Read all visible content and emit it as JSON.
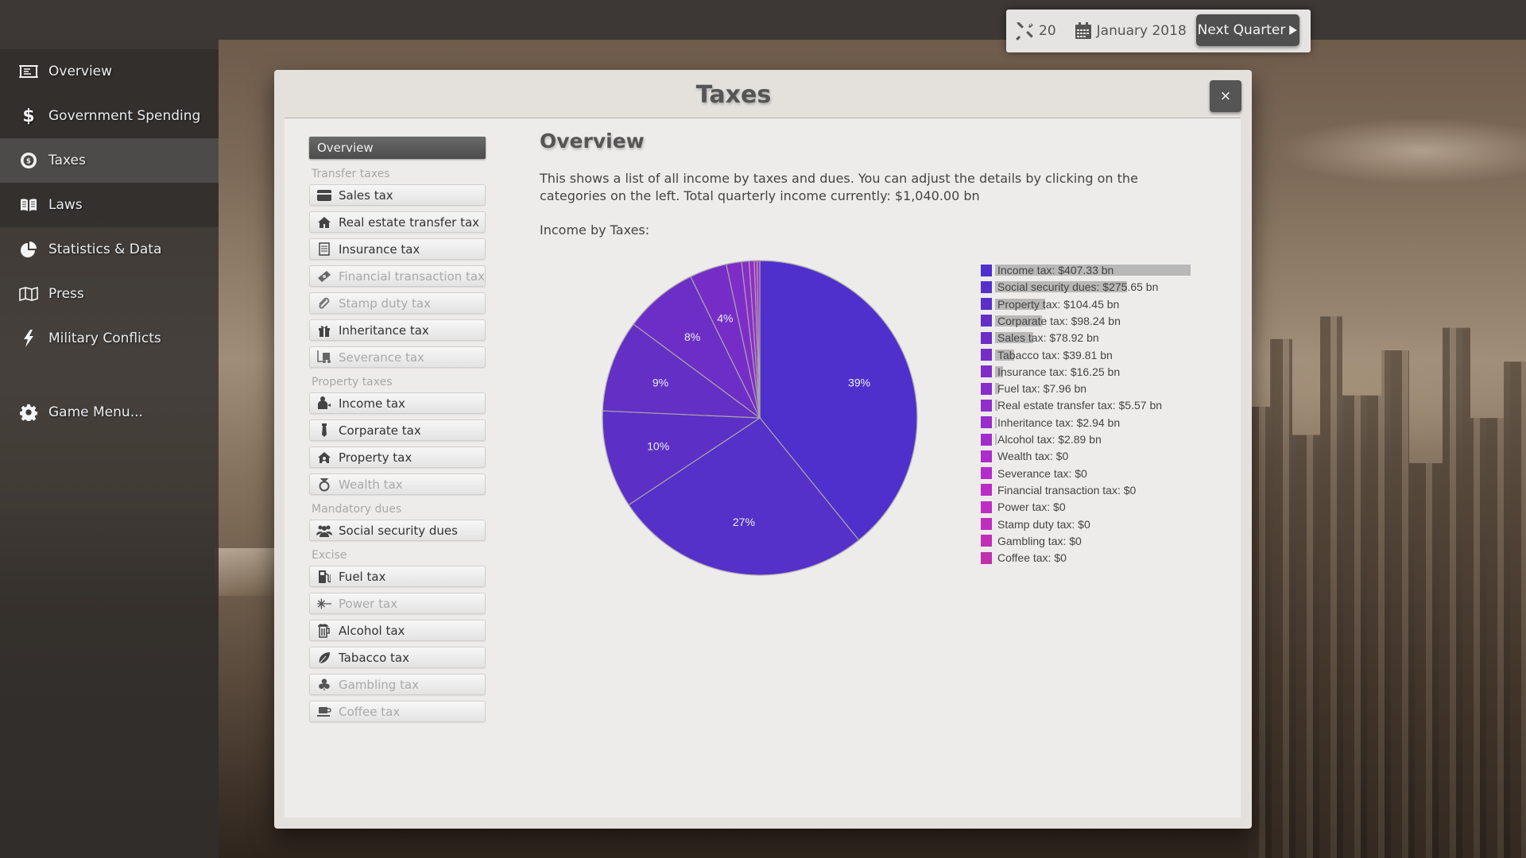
{
  "topbar": {
    "tools_count": "20",
    "tools_icon": "tools-icon",
    "date": "January 2018",
    "calendar_icon": "calendar-icon",
    "next_quarter_label": "Next Quarter",
    "next_quarter_icon": "play-icon"
  },
  "sidebar": {
    "items": [
      {
        "label": "Overview",
        "icon": "newspaper-icon",
        "active": false
      },
      {
        "label": "Government Spending",
        "icon": "dollar-icon",
        "active": false
      },
      {
        "label": "Taxes",
        "icon": "coin-icon",
        "active": true
      },
      {
        "label": "Laws",
        "icon": "book-icon",
        "active": false
      },
      {
        "label": "Statistics & Data",
        "icon": "pie-chart-icon",
        "active": false
      },
      {
        "label": "Press",
        "icon": "map-icon",
        "active": false
      },
      {
        "label": "Military Conflicts",
        "icon": "lightning-icon",
        "active": false
      },
      {
        "label": "Game Menu...",
        "icon": "gear-icon",
        "active": false
      }
    ]
  },
  "modal": {
    "title": "Taxes",
    "close_label": "×"
  },
  "tax_nav": {
    "overview_label": "Overview",
    "groups": [
      {
        "label": "Transfer taxes",
        "items": [
          {
            "label": "Sales tax",
            "icon": "credit-card-icon",
            "enabled": true
          },
          {
            "label": "Real estate transfer tax",
            "icon": "home-icon",
            "enabled": true
          },
          {
            "label": "Insurance tax",
            "icon": "document-icon",
            "enabled": true
          },
          {
            "label": "Financial transaction tax",
            "icon": "money-icon",
            "enabled": false
          },
          {
            "label": "Stamp duty tax",
            "icon": "paperclip-icon",
            "enabled": false
          },
          {
            "label": "Inheritance tax",
            "icon": "gift-icon",
            "enabled": true
          },
          {
            "label": "Severance tax",
            "icon": "forklift-icon",
            "enabled": false
          }
        ]
      },
      {
        "label": "Property taxes",
        "items": [
          {
            "label": "Income tax",
            "icon": "person-income-icon",
            "enabled": true
          },
          {
            "label": "Corparate tax",
            "icon": "tie-icon",
            "enabled": true
          },
          {
            "label": "Property tax",
            "icon": "house-person-icon",
            "enabled": true
          },
          {
            "label": "Wealth tax",
            "icon": "ring-icon",
            "enabled": false
          }
        ]
      },
      {
        "label": "Mandatory dues",
        "items": [
          {
            "label": "Social security dues",
            "icon": "group-icon",
            "enabled": true
          }
        ]
      },
      {
        "label": "Excise",
        "items": [
          {
            "label": "Fuel tax",
            "icon": "fuel-pump-icon",
            "enabled": true
          },
          {
            "label": "Power tax",
            "icon": "power-icon",
            "enabled": false
          },
          {
            "label": "Alcohol tax",
            "icon": "beer-icon",
            "enabled": true
          },
          {
            "label": "Tabacco tax",
            "icon": "leaf-icon",
            "enabled": true
          },
          {
            "label": "Gambling tax",
            "icon": "club-icon",
            "enabled": false
          },
          {
            "label": "Coffee tax",
            "icon": "coffee-icon",
            "enabled": false
          }
        ]
      }
    ]
  },
  "content": {
    "title": "Overview",
    "description": "This shows a list of all income by taxes and dues. You can adjust the details by clicking on the categories on the left. Total quarterly income currently:  $1,040.00 bn",
    "chart_label": "Income by Taxes:"
  },
  "chart_data": {
    "type": "pie",
    "title": "Income by Taxes",
    "unit": "$ bn",
    "legend_position": "right",
    "slices": [
      {
        "label": "Income tax",
        "value": 407.33,
        "display": "$407.33 bn",
        "color": "#4f30cc",
        "pct_label": "39%"
      },
      {
        "label": "Social security dues",
        "value": 275.65,
        "display": "$275.65 bn",
        "color": "#5530c9",
        "pct_label": "27%"
      },
      {
        "label": "Property tax",
        "value": 104.45,
        "display": "$104.45 bn",
        "color": "#5c2fc6",
        "pct_label": "10%"
      },
      {
        "label": "Corparate tax",
        "value": 98.24,
        "display": "$98.24 bn",
        "color": "#642fc5",
        "pct_label": "9%"
      },
      {
        "label": "Sales tax",
        "value": 78.92,
        "display": "$78.92 bn",
        "color": "#6c2ec6",
        "pct_label": "8%"
      },
      {
        "label": "Tabacco tax",
        "value": 39.81,
        "display": "$39.81 bn",
        "color": "#762dc7",
        "pct_label": "4%"
      },
      {
        "label": "Insurance tax",
        "value": 16.25,
        "display": "$16.25 bn",
        "color": "#7f2dc8",
        "pct_label": ""
      },
      {
        "label": "Fuel tax",
        "value": 7.96,
        "display": "$7.96 bn",
        "color": "#882dc9",
        "pct_label": ""
      },
      {
        "label": "Real estate transfer tax",
        "value": 5.57,
        "display": "$5.57 bn",
        "color": "#912dca",
        "pct_label": ""
      },
      {
        "label": "Inheritance tax",
        "value": 2.94,
        "display": "$2.94 bn",
        "color": "#9a2ccb",
        "pct_label": ""
      },
      {
        "label": "Alcohol tax",
        "value": 2.89,
        "display": "$2.89 bn",
        "color": "#a32ccc",
        "pct_label": ""
      },
      {
        "label": "Wealth tax",
        "value": 0,
        "display": "$0",
        "color": "#ad2ccc",
        "pct_label": ""
      },
      {
        "label": "Severance tax",
        "value": 0,
        "display": "$0",
        "color": "#b42ccb",
        "pct_label": ""
      },
      {
        "label": "Financial transaction tax",
        "value": 0,
        "display": "$0",
        "color": "#ba2cc8",
        "pct_label": ""
      },
      {
        "label": "Power tax",
        "value": 0,
        "display": "$0",
        "color": "#be2dc4",
        "pct_label": ""
      },
      {
        "label": "Stamp duty tax",
        "value": 0,
        "display": "$0",
        "color": "#c02ebe",
        "pct_label": ""
      },
      {
        "label": "Gambling tax",
        "value": 0,
        "display": "$0",
        "color": "#c02fb6",
        "pct_label": ""
      },
      {
        "label": "Coffee tax",
        "value": 0,
        "display": "$0",
        "color": "#c030ad",
        "pct_label": ""
      }
    ]
  }
}
